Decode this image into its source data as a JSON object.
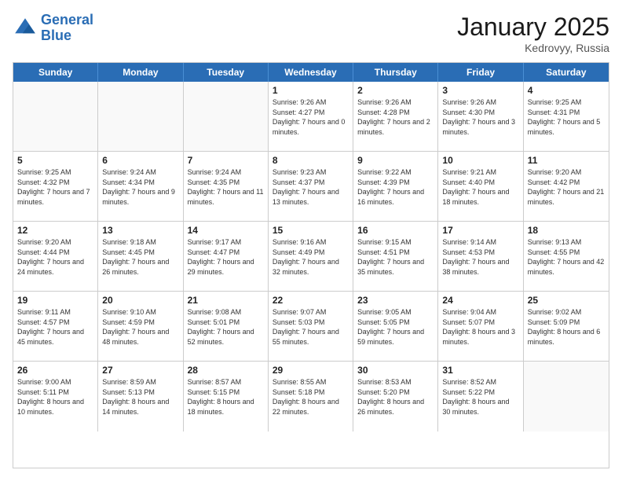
{
  "header": {
    "logo_line1": "General",
    "logo_line2": "Blue",
    "month": "January 2025",
    "location": "Kedrovyy, Russia"
  },
  "weekdays": [
    "Sunday",
    "Monday",
    "Tuesday",
    "Wednesday",
    "Thursday",
    "Friday",
    "Saturday"
  ],
  "rows": [
    [
      {
        "day": "",
        "info": ""
      },
      {
        "day": "",
        "info": ""
      },
      {
        "day": "",
        "info": ""
      },
      {
        "day": "1",
        "info": "Sunrise: 9:26 AM\nSunset: 4:27 PM\nDaylight: 7 hours and 0 minutes."
      },
      {
        "day": "2",
        "info": "Sunrise: 9:26 AM\nSunset: 4:28 PM\nDaylight: 7 hours and 2 minutes."
      },
      {
        "day": "3",
        "info": "Sunrise: 9:26 AM\nSunset: 4:30 PM\nDaylight: 7 hours and 3 minutes."
      },
      {
        "day": "4",
        "info": "Sunrise: 9:25 AM\nSunset: 4:31 PM\nDaylight: 7 hours and 5 minutes."
      }
    ],
    [
      {
        "day": "5",
        "info": "Sunrise: 9:25 AM\nSunset: 4:32 PM\nDaylight: 7 hours and 7 minutes."
      },
      {
        "day": "6",
        "info": "Sunrise: 9:24 AM\nSunset: 4:34 PM\nDaylight: 7 hours and 9 minutes."
      },
      {
        "day": "7",
        "info": "Sunrise: 9:24 AM\nSunset: 4:35 PM\nDaylight: 7 hours and 11 minutes."
      },
      {
        "day": "8",
        "info": "Sunrise: 9:23 AM\nSunset: 4:37 PM\nDaylight: 7 hours and 13 minutes."
      },
      {
        "day": "9",
        "info": "Sunrise: 9:22 AM\nSunset: 4:39 PM\nDaylight: 7 hours and 16 minutes."
      },
      {
        "day": "10",
        "info": "Sunrise: 9:21 AM\nSunset: 4:40 PM\nDaylight: 7 hours and 18 minutes."
      },
      {
        "day": "11",
        "info": "Sunrise: 9:20 AM\nSunset: 4:42 PM\nDaylight: 7 hours and 21 minutes."
      }
    ],
    [
      {
        "day": "12",
        "info": "Sunrise: 9:20 AM\nSunset: 4:44 PM\nDaylight: 7 hours and 24 minutes."
      },
      {
        "day": "13",
        "info": "Sunrise: 9:18 AM\nSunset: 4:45 PM\nDaylight: 7 hours and 26 minutes."
      },
      {
        "day": "14",
        "info": "Sunrise: 9:17 AM\nSunset: 4:47 PM\nDaylight: 7 hours and 29 minutes."
      },
      {
        "day": "15",
        "info": "Sunrise: 9:16 AM\nSunset: 4:49 PM\nDaylight: 7 hours and 32 minutes."
      },
      {
        "day": "16",
        "info": "Sunrise: 9:15 AM\nSunset: 4:51 PM\nDaylight: 7 hours and 35 minutes."
      },
      {
        "day": "17",
        "info": "Sunrise: 9:14 AM\nSunset: 4:53 PM\nDaylight: 7 hours and 38 minutes."
      },
      {
        "day": "18",
        "info": "Sunrise: 9:13 AM\nSunset: 4:55 PM\nDaylight: 7 hours and 42 minutes."
      }
    ],
    [
      {
        "day": "19",
        "info": "Sunrise: 9:11 AM\nSunset: 4:57 PM\nDaylight: 7 hours and 45 minutes."
      },
      {
        "day": "20",
        "info": "Sunrise: 9:10 AM\nSunset: 4:59 PM\nDaylight: 7 hours and 48 minutes."
      },
      {
        "day": "21",
        "info": "Sunrise: 9:08 AM\nSunset: 5:01 PM\nDaylight: 7 hours and 52 minutes."
      },
      {
        "day": "22",
        "info": "Sunrise: 9:07 AM\nSunset: 5:03 PM\nDaylight: 7 hours and 55 minutes."
      },
      {
        "day": "23",
        "info": "Sunrise: 9:05 AM\nSunset: 5:05 PM\nDaylight: 7 hours and 59 minutes."
      },
      {
        "day": "24",
        "info": "Sunrise: 9:04 AM\nSunset: 5:07 PM\nDaylight: 8 hours and 3 minutes."
      },
      {
        "day": "25",
        "info": "Sunrise: 9:02 AM\nSunset: 5:09 PM\nDaylight: 8 hours and 6 minutes."
      }
    ],
    [
      {
        "day": "26",
        "info": "Sunrise: 9:00 AM\nSunset: 5:11 PM\nDaylight: 8 hours and 10 minutes."
      },
      {
        "day": "27",
        "info": "Sunrise: 8:59 AM\nSunset: 5:13 PM\nDaylight: 8 hours and 14 minutes."
      },
      {
        "day": "28",
        "info": "Sunrise: 8:57 AM\nSunset: 5:15 PM\nDaylight: 8 hours and 18 minutes."
      },
      {
        "day": "29",
        "info": "Sunrise: 8:55 AM\nSunset: 5:18 PM\nDaylight: 8 hours and 22 minutes."
      },
      {
        "day": "30",
        "info": "Sunrise: 8:53 AM\nSunset: 5:20 PM\nDaylight: 8 hours and 26 minutes."
      },
      {
        "day": "31",
        "info": "Sunrise: 8:52 AM\nSunset: 5:22 PM\nDaylight: 8 hours and 30 minutes."
      },
      {
        "day": "",
        "info": ""
      }
    ]
  ]
}
